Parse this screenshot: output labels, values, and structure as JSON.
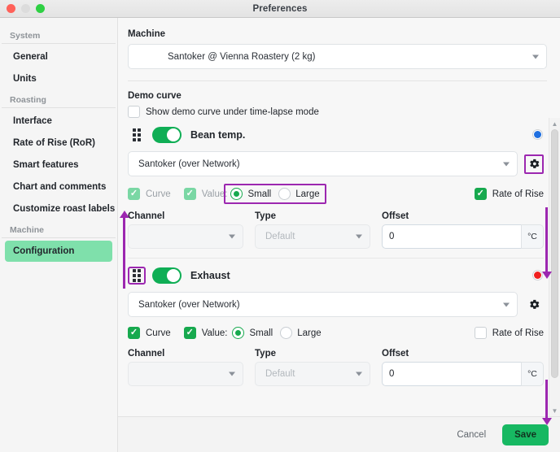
{
  "window": {
    "title": "Preferences",
    "controls": [
      "close",
      "minimize",
      "zoom"
    ]
  },
  "colors": {
    "accent_green": "#17a94e",
    "toggle_green": "#0fae55",
    "active_item_green": "#7fe0ab",
    "save_green": "#17b862",
    "annotation_purple": "#9c27b0",
    "bean_dot": "#1f6fe0",
    "exhaust_dot": "#f01f1f"
  },
  "sidebar": {
    "groups": [
      {
        "label": "System",
        "items": [
          {
            "label": "General",
            "active": false
          },
          {
            "label": "Units",
            "active": false
          }
        ]
      },
      {
        "label": "Roasting",
        "items": [
          {
            "label": "Interface",
            "active": false
          },
          {
            "label": "Rate of Rise (RoR)",
            "active": false
          },
          {
            "label": "Smart features",
            "active": false
          },
          {
            "label": "Chart and comments",
            "active": false
          },
          {
            "label": "Customize roast labels",
            "active": false
          }
        ]
      },
      {
        "label": "Machine",
        "items": [
          {
            "label": "Configuration",
            "active": true
          }
        ]
      }
    ]
  },
  "main": {
    "machine": {
      "label": "Machine",
      "selected": "Santoker  @ Vienna Roastery (2 kg)"
    },
    "demo_curve": {
      "label": "Demo curve",
      "checkbox_label": "Show demo curve under time-lapse mode",
      "checked": false
    },
    "devices": [
      {
        "name": "Bean temp.",
        "enabled": true,
        "dot_color": "#1f6fe0",
        "source": "Santoker (over Network)",
        "curve": {
          "label": "Curve",
          "checked": true,
          "disabled": true
        },
        "value": {
          "label": "Value:",
          "checked": true,
          "disabled": true
        },
        "size_options": [
          {
            "label": "Small",
            "selected": true
          },
          {
            "label": "Large",
            "selected": false
          }
        ],
        "rate_of_rise": {
          "label": "Rate of Rise",
          "checked": true
        },
        "channel": {
          "label": "Channel",
          "value": ""
        },
        "type": {
          "label": "Type",
          "placeholder": "Default"
        },
        "offset": {
          "label": "Offset",
          "value": "0",
          "unit": "°C"
        }
      },
      {
        "name": "Exhaust",
        "enabled": true,
        "dot_color": "#f01f1f",
        "source": "Santoker (over Network)",
        "curve": {
          "label": "Curve",
          "checked": true,
          "disabled": false
        },
        "value": {
          "label": "Value:",
          "checked": true,
          "disabled": false
        },
        "size_options": [
          {
            "label": "Small",
            "selected": true
          },
          {
            "label": "Large",
            "selected": false
          }
        ],
        "rate_of_rise": {
          "label": "Rate of Rise",
          "checked": false
        },
        "channel": {
          "label": "Channel",
          "value": ""
        },
        "type": {
          "label": "Type",
          "placeholder": "Default"
        },
        "offset": {
          "label": "Offset",
          "value": "0",
          "unit": "°C"
        }
      }
    ]
  },
  "footer": {
    "cancel_label": "Cancel",
    "save_label": "Save"
  },
  "icons": {
    "gear": "gear-icon",
    "grip": "drag-handle-icon",
    "caret": "chevron-down-icon",
    "check": "check-icon"
  }
}
